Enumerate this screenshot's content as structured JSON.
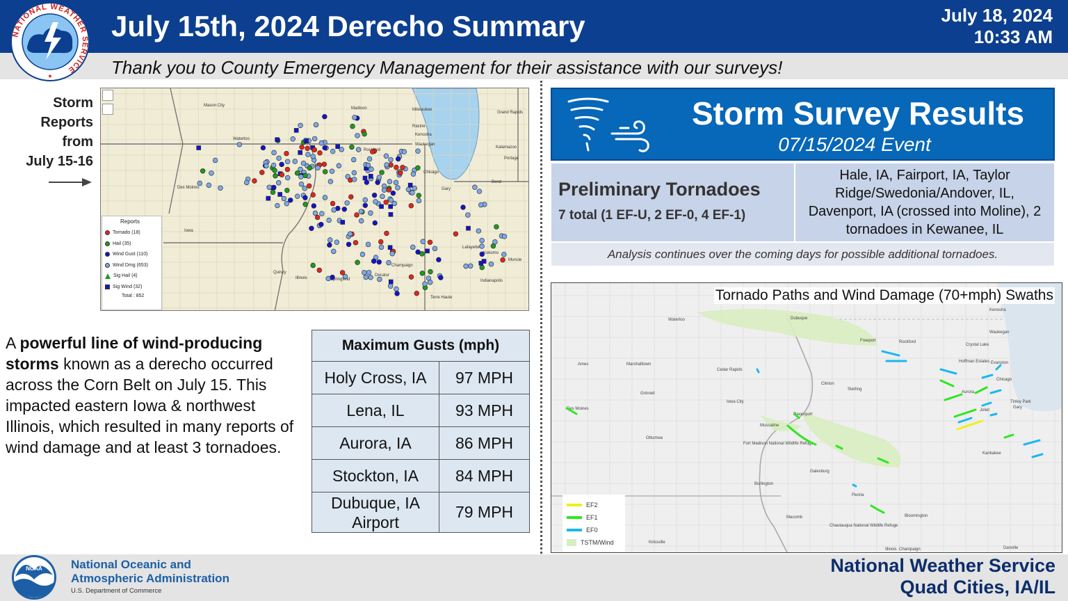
{
  "header": {
    "title": "July 15th, 2024 Derecho Summary",
    "date": "July 18, 2024",
    "time": "10:33 AM",
    "subtitle": "Thank you to County Emergency Management for their assistance with our surveys!",
    "logo_text": "NATIONAL WEATHER SERVICE"
  },
  "storm_reports": {
    "label_lines": [
      "Storm",
      "Reports",
      "from",
      "July 15-16"
    ],
    "legend_title": "Reports",
    "legend": [
      {
        "label": "Tornado (18)",
        "color": "#e3261b",
        "shape": "circle"
      },
      {
        "label": "Hail (35)",
        "color": "#1f9a1f",
        "shape": "circle"
      },
      {
        "label": "Wind Gust (110)",
        "color": "#1414c8",
        "shape": "circle"
      },
      {
        "label": "Wind Dmg (653)",
        "color": "#7ea9e6",
        "shape": "circle"
      },
      {
        "label": "Sig Hail (4)",
        "color": "#1f9a1f",
        "shape": "triangle"
      },
      {
        "label": "Sig Wind (32)",
        "color": "#1414c8",
        "shape": "square"
      }
    ],
    "legend_total": "Total : 852",
    "map_labels": [
      "Madison",
      "Milwaukee",
      "Racine",
      "Kenosha",
      "Waukegan",
      "Grand Rapids",
      "Kalamazoo",
      "Portage",
      "Rockford",
      "Waterloo",
      "Chicago",
      "Des Moines",
      "Iowa",
      "Quincy",
      "Illinois",
      "Springfield",
      "Lafayette",
      "Kokomo",
      "Muncie",
      "Terre Haute",
      "Indianapolis",
      "Champaign",
      "Decatur",
      "Gary",
      "Mason City",
      "Bend"
    ]
  },
  "description": {
    "pre": "A ",
    "bold": "powerful line of wind-producing storms",
    "post": " known as a derecho occurred across the Corn Belt on July 15. This impacted eastern Iowa & northwest Illinois, which resulted in many reports of wind damage and at least 3 tornadoes."
  },
  "gusts": {
    "header": "Maximum Gusts (mph)",
    "rows": [
      {
        "location": "Holy Cross, IA",
        "speed": "97 MPH"
      },
      {
        "location": "Lena, IL",
        "speed": "93 MPH"
      },
      {
        "location": "Aurora, IA",
        "speed": "86 MPH"
      },
      {
        "location": "Stockton, IA",
        "speed": "84 MPH"
      },
      {
        "location": "Dubuque, IA Airport",
        "speed": "79 MPH"
      }
    ]
  },
  "survey": {
    "title": "Storm Survey Results",
    "event": "07/15/2024 Event",
    "prelim_label": "Preliminary Tornadoes",
    "total": "7 total",
    "breakdown": "(1 EF-U, 2 EF-0, 4 EF-1)",
    "locations": "Hale, IA, Fairport, IA, Taylor Ridge/Swedonia/Andover, IL, Davenport, IA (crossed into Moline), 2 tornadoes in Kewanee, IL",
    "analysis": "Analysis continues over the coming days for possible additional tornadoes."
  },
  "paths_map": {
    "title": "Tornado Paths and Wind Damage (70+mph) Swaths",
    "legend": [
      {
        "label": "EF2",
        "color": "#f2ee1c"
      },
      {
        "label": "EF1",
        "color": "#2fe61f"
      },
      {
        "label": "EF0",
        "color": "#1ab8f0"
      },
      {
        "label": "TSTM/Wind",
        "color": "#d8edc0"
      }
    ],
    "labels": [
      "Waterloo",
      "Dubuque",
      "Freeport",
      "Rockford",
      "Kenosha",
      "Waukegan",
      "Crystal Lake",
      "Hoffman Estates",
      "Evanston",
      "Chicago",
      "Aurora",
      "Joliet",
      "Tinley Park",
      "Gary",
      "Kankakee",
      "Ames",
      "Marshalltown",
      "Cedar Rapids",
      "Clinton",
      "Sterling",
      "Des Moines",
      "Grinnell",
      "Iowa City",
      "Davenport",
      "Muscatine",
      "Ottumwa",
      "Galesburg",
      "Peoria",
      "Burlington",
      "Macomb",
      "Bloomington",
      "Kirksville",
      "Champaign",
      "Danville",
      "Illinois",
      "Fort Madison National Wildlife Refuge",
      "Chautauqua National Wildlife Refuge"
    ]
  },
  "footer": {
    "noaa_line1": "National Oceanic and",
    "noaa_line2": "Atmospheric Administration",
    "noaa_dept": "U.S. Department of Commerce",
    "noaa_logo": "NOAA",
    "nws_line1": "National Weather Service",
    "nws_line2": "Quad Cities, IA/IL"
  }
}
